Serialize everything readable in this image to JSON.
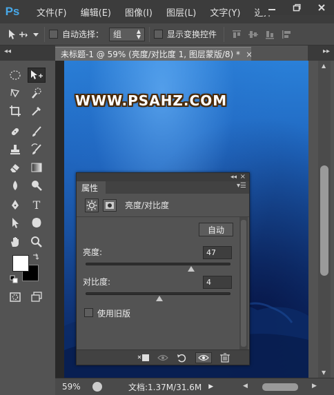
{
  "app": {
    "logo": "Ps"
  },
  "menu": [
    "文件(F)",
    "编辑(E)",
    "图像(I)",
    "图层(L)",
    "文字(Y)",
    "选择"
  ],
  "window_controls": [
    "minimize-icon",
    "restore-icon",
    "close-icon"
  ],
  "options_bar": {
    "auto_select_label": "自动选择：",
    "auto_select_checked": false,
    "auto_select_value": "组",
    "show_transform_label": "显示变换控件",
    "show_transform_checked": false
  },
  "document": {
    "tab_title": "未标题-1 @ 59% (亮度/对比度 1, 图层蒙版/8) *",
    "watermark_text": "WWW.PSAHZ.COM"
  },
  "status": {
    "zoom": "59%",
    "doc_info": "文档:1.37M/31.6M"
  },
  "properties_panel": {
    "tab_label": "属性",
    "adjustment_title": "亮度/对比度",
    "auto_button": "自动",
    "brightness": {
      "label": "亮度:",
      "value": "47",
      "slider_fraction": 0.73
    },
    "contrast": {
      "label": "对比度:",
      "value": "4",
      "slider_fraction": 0.51
    },
    "legacy_label": "使用旧版",
    "legacy_checked": false
  },
  "colors": {
    "foreground": "#ffffff",
    "background": "#000000",
    "ui_dark": "#3c3c3c",
    "ui_panel": "#535353",
    "ps_blue": "#47a8e8",
    "canvas_blue": "#1f66bf"
  }
}
